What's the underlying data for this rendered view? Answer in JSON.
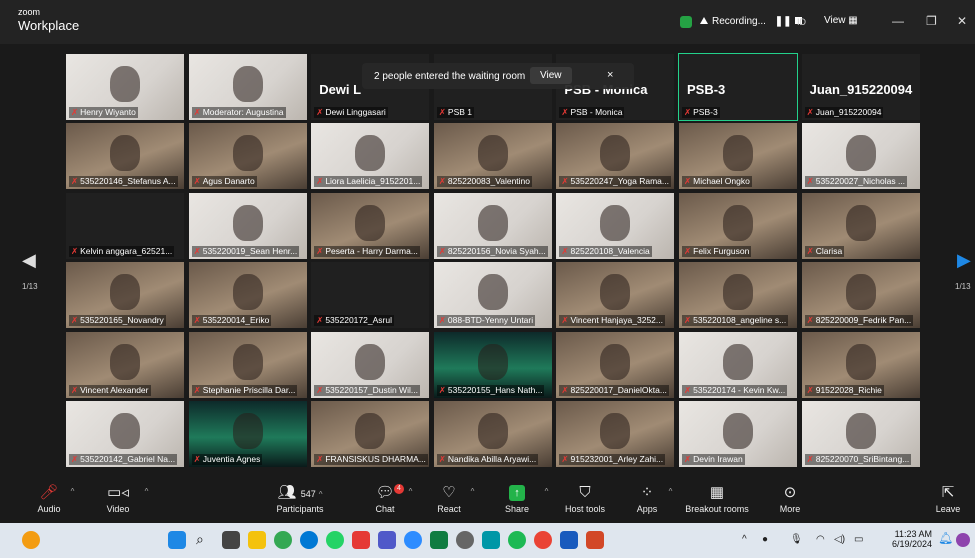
{
  "app": {
    "brand_small": "zoom",
    "brand_big": "Workplace"
  },
  "recording": {
    "label": "Recording...",
    "id_label": "ID",
    "view_label": "View"
  },
  "toast": {
    "message": "2 people entered the waiting room",
    "view": "View",
    "close": "×"
  },
  "pagination": {
    "left": "1/13",
    "right": "1/13"
  },
  "tiles": [
    {
      "name": "Henry Wiyanto",
      "style": "light"
    },
    {
      "name": "Moderator: Augustina",
      "style": "light"
    },
    {
      "name": "Dewi Linggasari",
      "big": "Dewi L",
      "style": "dark"
    },
    {
      "name": "PSB 1",
      "style": "dark"
    },
    {
      "name": "PSB - Monica",
      "big": "PSB - Monica",
      "style": "dark"
    },
    {
      "name": "PSB-3",
      "big": "PSB-3",
      "style": "dark",
      "active": true
    },
    {
      "name": "Juan_915220094",
      "big": "Juan_915220094",
      "style": "dark"
    },
    {
      "name": "535220146_Stefanus A...",
      "style": "warm"
    },
    {
      "name": "Agus Danarto",
      "style": "warm"
    },
    {
      "name": "Liora Laelicia_9152201...",
      "style": "light"
    },
    {
      "name": "825220083_Valentino",
      "style": "warm"
    },
    {
      "name": "535220247_Yoga Rama...",
      "style": "warm"
    },
    {
      "name": "Michael Ongko",
      "style": "warm"
    },
    {
      "name": "535220027_Nicholas ...",
      "style": "light"
    },
    {
      "name": "Kelvin anggara_62521...",
      "style": "dark"
    },
    {
      "name": "535220019_Sean Henr...",
      "style": "light"
    },
    {
      "name": "Peserta - Harry Darma...",
      "style": "warm"
    },
    {
      "name": "825220156_Novia Syah...",
      "style": "light"
    },
    {
      "name": "825220108_Valencia",
      "style": "light"
    },
    {
      "name": "Felix Furguson",
      "style": "warm"
    },
    {
      "name": "Clarisa",
      "style": "warm"
    },
    {
      "name": "535220165_Novandry",
      "style": "warm"
    },
    {
      "name": "535220014_Eriko",
      "style": "warm"
    },
    {
      "name": "535220172_Asrul",
      "style": "dark"
    },
    {
      "name": "088-BTD-Yenny Untari",
      "style": "light"
    },
    {
      "name": "Vincent Hanjaya_3252...",
      "style": "warm"
    },
    {
      "name": "535220108_angeline s...",
      "style": "warm"
    },
    {
      "name": "825220009_Fedrik Pan...",
      "style": "warm"
    },
    {
      "name": "Vincent Alexander",
      "style": "warm"
    },
    {
      "name": "Stephanie Priscilla Dar...",
      "style": "warm"
    },
    {
      "name": "535220157_Dustin Wil...",
      "style": "light"
    },
    {
      "name": "535220155_Hans Nath...",
      "style": "aurora"
    },
    {
      "name": "825220017_DanielOkta...",
      "style": "warm"
    },
    {
      "name": "535220174 - Kevin Kw...",
      "style": "light"
    },
    {
      "name": "91522028_Richie",
      "style": "warm"
    },
    {
      "name": "535220142_Gabriel Na...",
      "style": "light"
    },
    {
      "name": "Juventia Agnes",
      "style": "aurora"
    },
    {
      "name": "FRANSISKUS DHARMA...",
      "style": "warm"
    },
    {
      "name": "Nandika Abilla Aryawi...",
      "style": "warm"
    },
    {
      "name": "915232001_Arley Zahi...",
      "style": "warm"
    },
    {
      "name": "Devin Irawan",
      "style": "light"
    },
    {
      "name": "825220070_SriBintang...",
      "style": "light"
    }
  ],
  "toolbar": {
    "audio": "Audio",
    "video": "Video",
    "participants": "Participants",
    "participants_count": "547",
    "chat": "Chat",
    "chat_badge": "4",
    "react": "React",
    "share": "Share",
    "host_tools": "Host tools",
    "apps": "Apps",
    "breakout": "Breakout rooms",
    "more": "More",
    "leave": "Leave"
  },
  "taskbar": {
    "time": "11:23 AM",
    "date": "6/19/2024"
  },
  "colors": {
    "accent_green": "#23d18b",
    "share_green": "#23b34a",
    "muted_red": "#e53935",
    "nav_blue": "#1e88e5"
  }
}
